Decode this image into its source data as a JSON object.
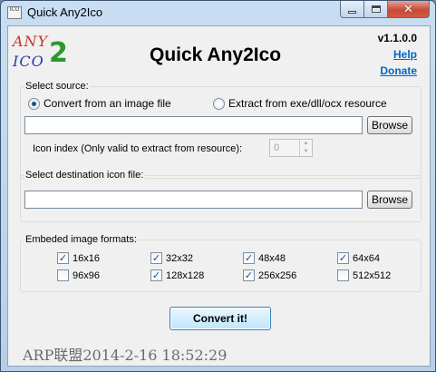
{
  "window": {
    "title": "Quick Any2Ico",
    "icon": "app-icon",
    "controls": {
      "minimize": "minimize-icon",
      "maximize": "maximize-icon",
      "close": "close-icon"
    },
    "close_glyph": "✕"
  },
  "header": {
    "logo": {
      "line1": "ANY",
      "line2": "ICO",
      "digit": "2"
    },
    "title": "Quick Any2Ico",
    "version": "v1.1.0.0",
    "help_link": "Help",
    "donate_link": "Donate"
  },
  "source": {
    "label": "Select source:",
    "radio_image": "Convert from an image file",
    "radio_resource": "Extract from exe/dll/ocx resource",
    "selected": "image",
    "path_value": "",
    "browse_label": "Browse",
    "icon_index_label": "Icon index (Only valid to extract from resource):",
    "icon_index_value": "0"
  },
  "destination": {
    "label": "Select destination icon file:",
    "path_value": "",
    "browse_label": "Browse"
  },
  "formats": {
    "label": "Embeded image formats:",
    "items": [
      {
        "label": "16x16",
        "checked": true
      },
      {
        "label": "32x32",
        "checked": true
      },
      {
        "label": "48x48",
        "checked": true
      },
      {
        "label": "64x64",
        "checked": true
      },
      {
        "label": "96x96",
        "checked": false
      },
      {
        "label": "128x128",
        "checked": true
      },
      {
        "label": "256x256",
        "checked": true
      },
      {
        "label": "512x512",
        "checked": false
      }
    ]
  },
  "convert_button": "Convert it!",
  "watermark": "ARP联盟2014-2-16 18:52:29",
  "colors": {
    "link": "#0066cc",
    "logo_red": "#c0392b",
    "logo_blue": "#1f3fa8",
    "logo_green": "#2a9a2a"
  }
}
